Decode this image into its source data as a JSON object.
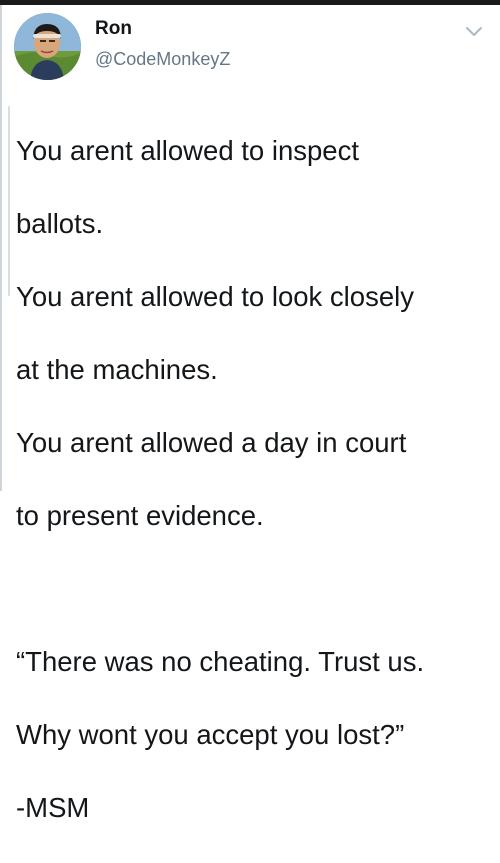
{
  "user": {
    "name": "Ron",
    "handle": "@CodeMonkeyZ"
  },
  "icons": {
    "menu": "chevron-down-icon",
    "avatar": "profile-photo"
  },
  "tweet": {
    "lines": [
      "You arent allowed to inspect",
      "ballots.",
      "You arent allowed to look closely",
      "at the machines.",
      "You arent allowed a day in court",
      "to present evidence.",
      "",
      "“There was no cheating. Trust us.",
      "Why wont you accept you lost?”",
      "-MSM"
    ]
  },
  "colors": {
    "text": "#14171a",
    "secondary": "#657786",
    "chevron": "#aab8c2"
  }
}
